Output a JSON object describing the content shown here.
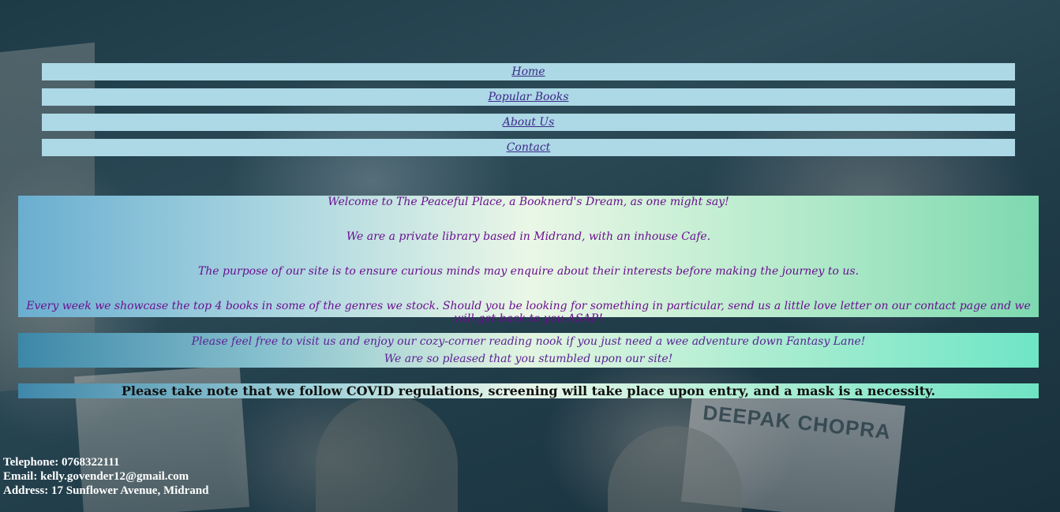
{
  "nav": {
    "items": [
      {
        "label": "Home"
      },
      {
        "label": "Popular Books"
      },
      {
        "label": "About Us"
      },
      {
        "label": "Contact"
      }
    ]
  },
  "welcome": {
    "line1": "Welcome to The Peaceful Place, a Booknerd's Dream, as one might say!",
    "line2": "We are a private library based in Midrand, with an inhouse Cafe.",
    "line3": "The purpose of our site is to ensure curious minds may enquire about their interests before making the journey to us.",
    "line4": "Every week we showcase the top 4 books in some of the genres we stock. Should you be looking for something in particular, send us a little love letter on our contact page and we will get back to you ASAP!"
  },
  "feel_free": {
    "line1": "Please feel free to visit us and enjoy our cozy-corner reading nook if you just need a wee adventure down Fantasy Lane!",
    "line2": "We are so pleased that you stumbled upon our site!"
  },
  "covid": {
    "notice": "Please take note that we follow COVID regulations, screening will take place upon entry, and a mask is a necessity."
  },
  "contact": {
    "telephone": "Telephone: 0768322111",
    "email": "Email: kelly.govender12@gmail.com",
    "address": "Address: 17 Sunflower Avenue, Midrand"
  },
  "background": {
    "book_text": "DEEPAK CHOPRA"
  },
  "colors": {
    "nav_bg": "#add8e6",
    "nav_link": "#3b2a86",
    "welcome_text": "#6a1090",
    "feel_free_text": "#5b2296"
  }
}
